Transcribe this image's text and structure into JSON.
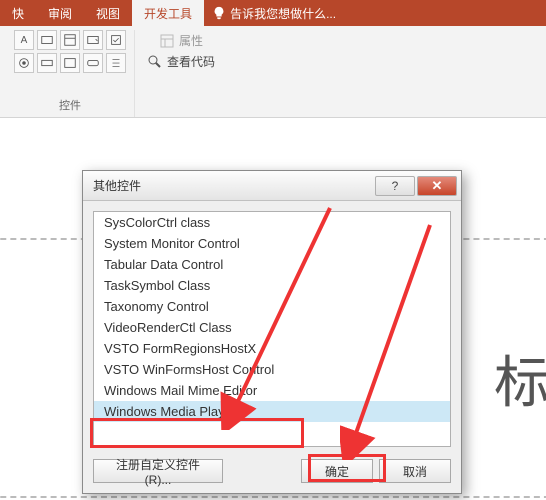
{
  "ribbon": {
    "tabs": [
      "快",
      "审阅",
      "视图",
      "开发工具"
    ],
    "active_tab": "开发工具",
    "tell_me": "告诉我您想做什么...",
    "group_controls_label": "控件",
    "properties": "属性",
    "view_code": "查看代码"
  },
  "slide": {
    "placeholder_text": "标"
  },
  "dialog": {
    "title": "其他控件",
    "items": [
      "SysColorCtrl class",
      "System Monitor Control",
      "Tabular Data Control",
      "TaskSymbol Class",
      "Taxonomy Control",
      "VideoRenderCtl Class",
      "VSTO FormRegionsHostX",
      "VSTO WinFormsHost Control",
      "Windows Mail Mime Editor",
      "Windows Media Player"
    ],
    "selected_index": 9,
    "register": "注册自定义控件(R)...",
    "ok": "确定",
    "cancel": "取消"
  }
}
